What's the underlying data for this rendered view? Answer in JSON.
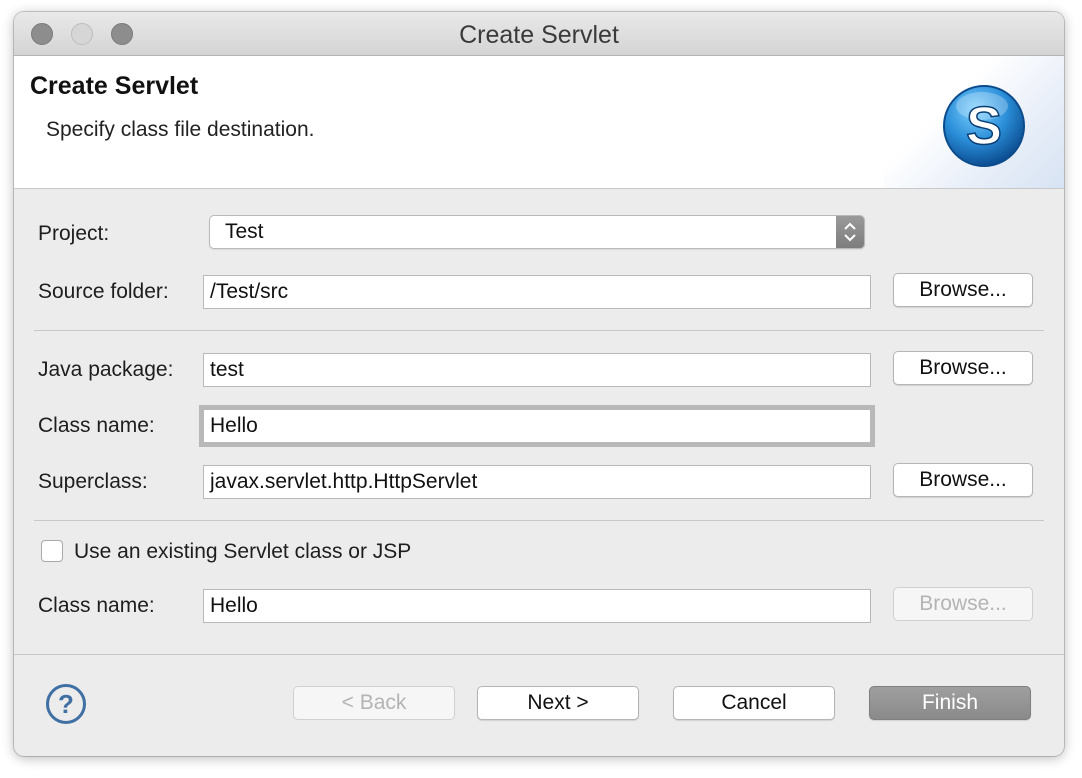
{
  "window": {
    "title": "Create Servlet"
  },
  "banner": {
    "title": "Create Servlet",
    "description": "Specify class file destination.",
    "logo_icon": "servlet-s-icon",
    "logo_letter": "S"
  },
  "form": {
    "project_label": "Project:",
    "project_value": "Test",
    "source_folder_label": "Source folder:",
    "source_folder_value": "/Test/src",
    "java_package_label": "Java package:",
    "java_package_value": "test",
    "class_name_label": "Class name:",
    "class_name_value": "Hello",
    "superclass_label": "Superclass:",
    "superclass_value": "javax.servlet.http.HttpServlet",
    "existing_checkbox_label": "Use an existing Servlet class or JSP",
    "existing_checked": false,
    "existing_class_label": "Class name:",
    "existing_class_value": "Hello",
    "browse_label": "Browse..."
  },
  "footer": {
    "help_icon": "question-mark-icon",
    "help_glyph": "?",
    "back_label": "< Back",
    "next_label": "Next >",
    "cancel_label": "Cancel",
    "finish_label": "Finish"
  },
  "colors": {
    "accent_blue": "#2f8fd8",
    "default_button": "#8f8f8f",
    "window_bg": "#ececec"
  }
}
